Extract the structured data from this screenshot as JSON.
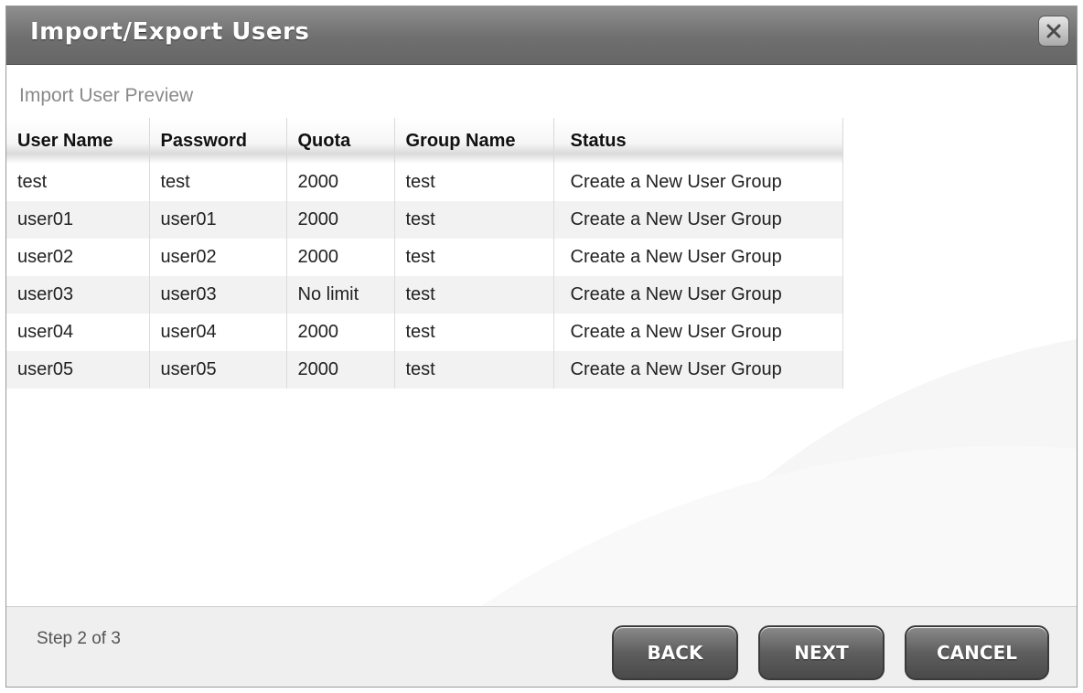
{
  "dialog": {
    "title": "Import/Export Users",
    "close_icon": "close-icon"
  },
  "content": {
    "subtitle": "Import User Preview",
    "columns": [
      "User Name",
      "Password",
      "Quota",
      "Group Name",
      "Status"
    ],
    "rows": [
      [
        "test",
        "test",
        "2000",
        "test",
        "Create a New User Group"
      ],
      [
        "user01",
        "user01",
        "2000",
        "test",
        "Create a New User Group"
      ],
      [
        "user02",
        "user02",
        "2000",
        "test",
        "Create a New User Group"
      ],
      [
        "user03",
        "user03",
        "No limit",
        "test",
        "Create a New User Group"
      ],
      [
        "user04",
        "user04",
        "2000",
        "test",
        "Create a New User Group"
      ],
      [
        "user05",
        "user05",
        "2000",
        "test",
        "Create a New User Group"
      ]
    ]
  },
  "footer": {
    "step": "Step 2 of 3",
    "back_label": "BACK",
    "next_label": "NEXT",
    "cancel_label": "CANCEL"
  },
  "colors": {
    "titlebar": "#7a7a7a",
    "button": "#5e5e5e",
    "footer_bg": "#efefef"
  }
}
